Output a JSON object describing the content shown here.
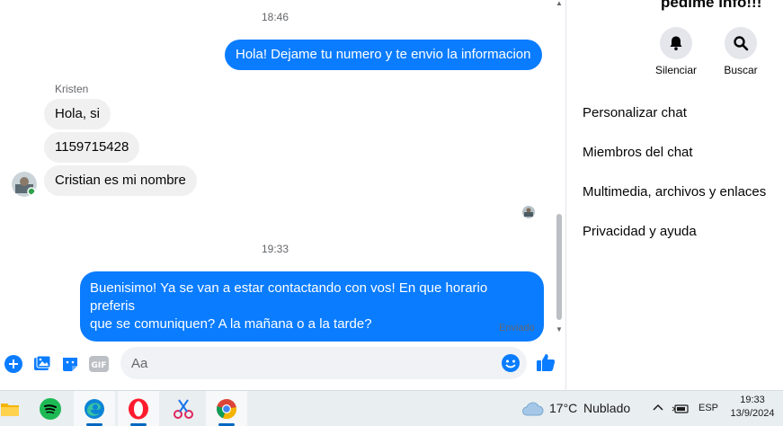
{
  "chat": {
    "timestamp_1": "18:46",
    "timestamp_2": "19:33",
    "sender_name": "Kristen",
    "messages": [
      {
        "direction": "out",
        "text": "Hola! Dejame tu numero y te envio la informacion"
      },
      {
        "direction": "in",
        "text": "Hola, si"
      },
      {
        "direction": "in",
        "text": "1159715428"
      },
      {
        "direction": "in",
        "text": "Cristian es mi nombre"
      },
      {
        "direction": "out",
        "text_line1": "Buenisimo! Ya se van a estar contactando con vos! En que horario preferis",
        "text_line2": "que se comuniquen? A la mañana o a la tarde?"
      }
    ],
    "status": "Enviado"
  },
  "composer": {
    "placeholder": "Aa",
    "icons": [
      "plus-icon",
      "image-icon",
      "sticker-icon",
      "gif-icon",
      "emoji-icon",
      "like-icon"
    ],
    "gif_label": "GIF"
  },
  "info": {
    "title": "pedime info!!!",
    "actions": [
      {
        "label": "Silenciar",
        "icon": "bell-icon"
      },
      {
        "label": "Buscar",
        "icon": "search-icon"
      }
    ],
    "menu": [
      "Personalizar chat",
      "Miembros del chat",
      "Multimedia, archivos y enlaces",
      "Privacidad y ayuda"
    ]
  },
  "taskbar": {
    "apps": [
      "file-explorer-icon",
      "spotify-icon",
      "edge-icon",
      "opera-icon",
      "snipping-tool-icon",
      "chrome-icon"
    ],
    "weather_temp": "17°C",
    "weather_desc": "Nublado",
    "language": "ESP",
    "time": "19:33",
    "date": "13/9/2024"
  },
  "colors": {
    "accent": "#0a7cff",
    "incoming_bubble": "#f0f0f0",
    "taskbar": "#e9eef0"
  }
}
